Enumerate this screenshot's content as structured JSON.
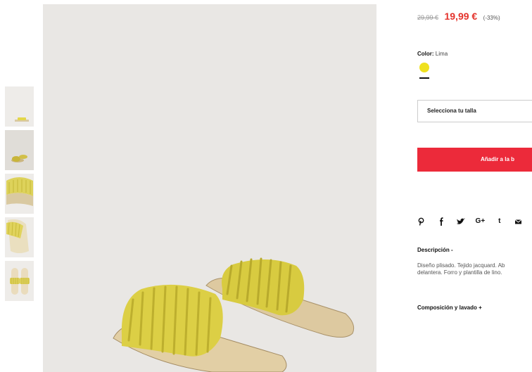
{
  "price": {
    "old": "29,99 €",
    "current": "19,99 €",
    "discount": "(-33%)"
  },
  "color": {
    "label": "Color:",
    "value": "Lima",
    "swatch": "#efe11f"
  },
  "size": {
    "placeholder": "Selecciona tu talla"
  },
  "cart": {
    "add_label": "Añadir a la b"
  },
  "social": {
    "icons": [
      "pinterest-icon",
      "facebook-icon",
      "twitter-icon",
      "google-plus-icon",
      "tumblr-icon",
      "email-icon"
    ],
    "google_plus": "G+",
    "tumblr": "t"
  },
  "description": {
    "title": "Descripción -",
    "line1": "Diseño plisado. Tejido jacquard. Ab",
    "line2": "delantera. Forro y plantilla de lino."
  },
  "composition": {
    "title": "Composición y lavado +"
  },
  "colors": {
    "accent": "#ec2a3a",
    "sale_price": "#e4322b",
    "background_image": "#e9e7e4"
  }
}
